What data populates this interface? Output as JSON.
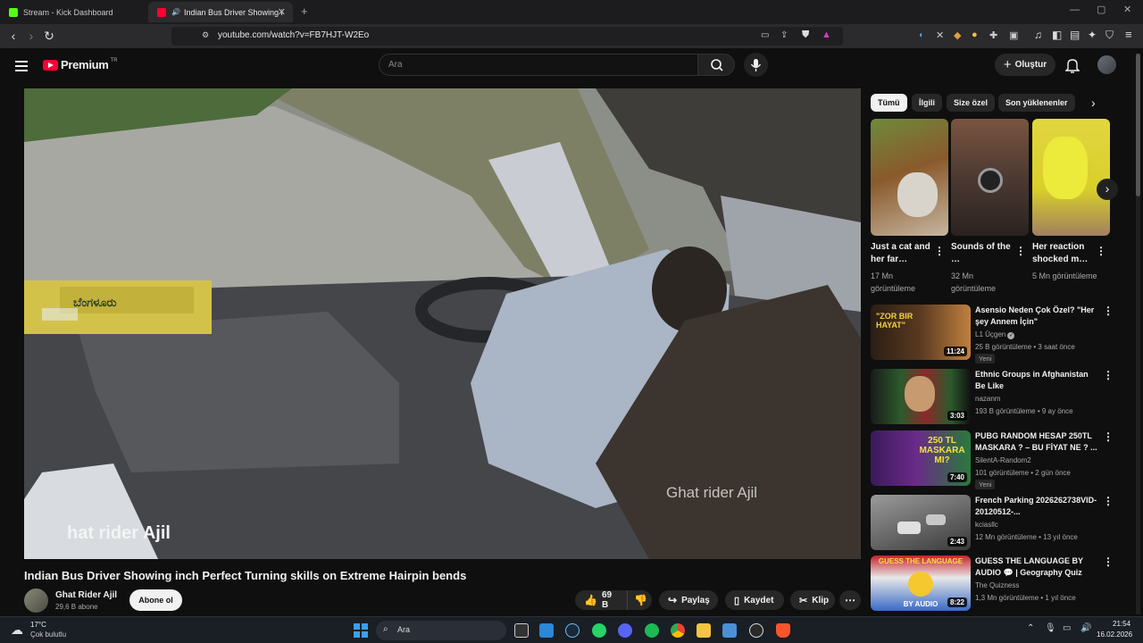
{
  "browser": {
    "tabs": [
      {
        "title": "Stream - Kick Dashboard",
        "active": false
      },
      {
        "title": "Indian Bus Driver Showing inch",
        "active": true
      }
    ],
    "url": "youtube.com/watch?v=FB7HJT-W2Eo"
  },
  "youtube": {
    "logo_text": "Premium",
    "logo_sup": "TR",
    "search_placeholder": "Ara",
    "create_label": "Oluştur"
  },
  "video": {
    "overlay_right": "Ghat rider Ajil",
    "overlay_left": "hat rider Ajil",
    "sticker_text": "ಬೆಂಗಳೂರು",
    "title": "Indian Bus Driver Showing inch Perfect Turning skills on Extreme Hairpin bends",
    "channel_name": "Ghat Rider Ajil",
    "channel_subs": "29,6 B abone",
    "subscribe_label": "Abone ol",
    "like_count": "69 B",
    "share_label": "Paylaş",
    "save_label": "Kaydet",
    "clip_label": "Klip"
  },
  "sidebar": {
    "chips": [
      "Tümü",
      "İlgili",
      "Size özel",
      "Son yüklenenler"
    ],
    "shorts": [
      {
        "title": "Just a cat and her far…",
        "views": "17 Mn görüntüleme",
        "color": "#8a5a2c"
      },
      {
        "title": "Sounds of the …",
        "views": "32 Mn görüntüleme",
        "color": "#4c3a32"
      },
      {
        "title": "Her reaction shocked m…",
        "views": "5 Mn görüntüleme",
        "color": "#d9cf2a"
      }
    ],
    "recommendations": [
      {
        "title": "Asensio Neden Çok Özel? \"Her şey Annem İçin\"",
        "channel": "L1 Üçgen",
        "meta": "25 B görüntüleme • 3 saat önce",
        "badge": "Yeni",
        "duration": "11:24",
        "thumb_text": "\"ZOR BIR HAYAT\"",
        "color": "#3a2a1a"
      },
      {
        "title": "Ethnic Groups in Afghanistan Be Like",
        "channel": "nazanm",
        "meta": "193 B görüntüleme • 9 ay önce",
        "badge": "",
        "duration": "3:03",
        "thumb_text": "",
        "color": "#2c5a2c"
      },
      {
        "title": "PUBG RANDOM HESAP 250TL MASKARA ? – BU FİYAT NE ? ...",
        "channel": "SilentA-Random2",
        "meta": "101 görüntüleme • 2 gün önce",
        "badge": "Yeni",
        "duration": "7:40",
        "thumb_text": "250 TL MASKARA MI?",
        "color": "#6a2a8a"
      },
      {
        "title": "French Parking 2026262738VID-20120512-...",
        "channel": "kciasllc",
        "meta": "12 Mn görüntüleme • 13 yıl önce",
        "badge": "",
        "duration": "2:43",
        "thumb_text": "",
        "color": "#777777"
      },
      {
        "title": "GUESS THE LANGUAGE BY AUDIO 💬 | Geography Quiz",
        "channel": "The Quizness",
        "meta": "1,3 Mn görüntüleme • 1 yıl önce",
        "badge": "",
        "duration": "8:22",
        "thumb_text": "GUESS THE LANGUAGE",
        "thumb_text2": "BY AUDIO",
        "color": "#c8202a"
      }
    ]
  },
  "taskbar": {
    "temp": "17°C",
    "weather": "Çok bulutlu",
    "search_label": "Ara",
    "time": "21:54",
    "date": "16.02.2026"
  }
}
